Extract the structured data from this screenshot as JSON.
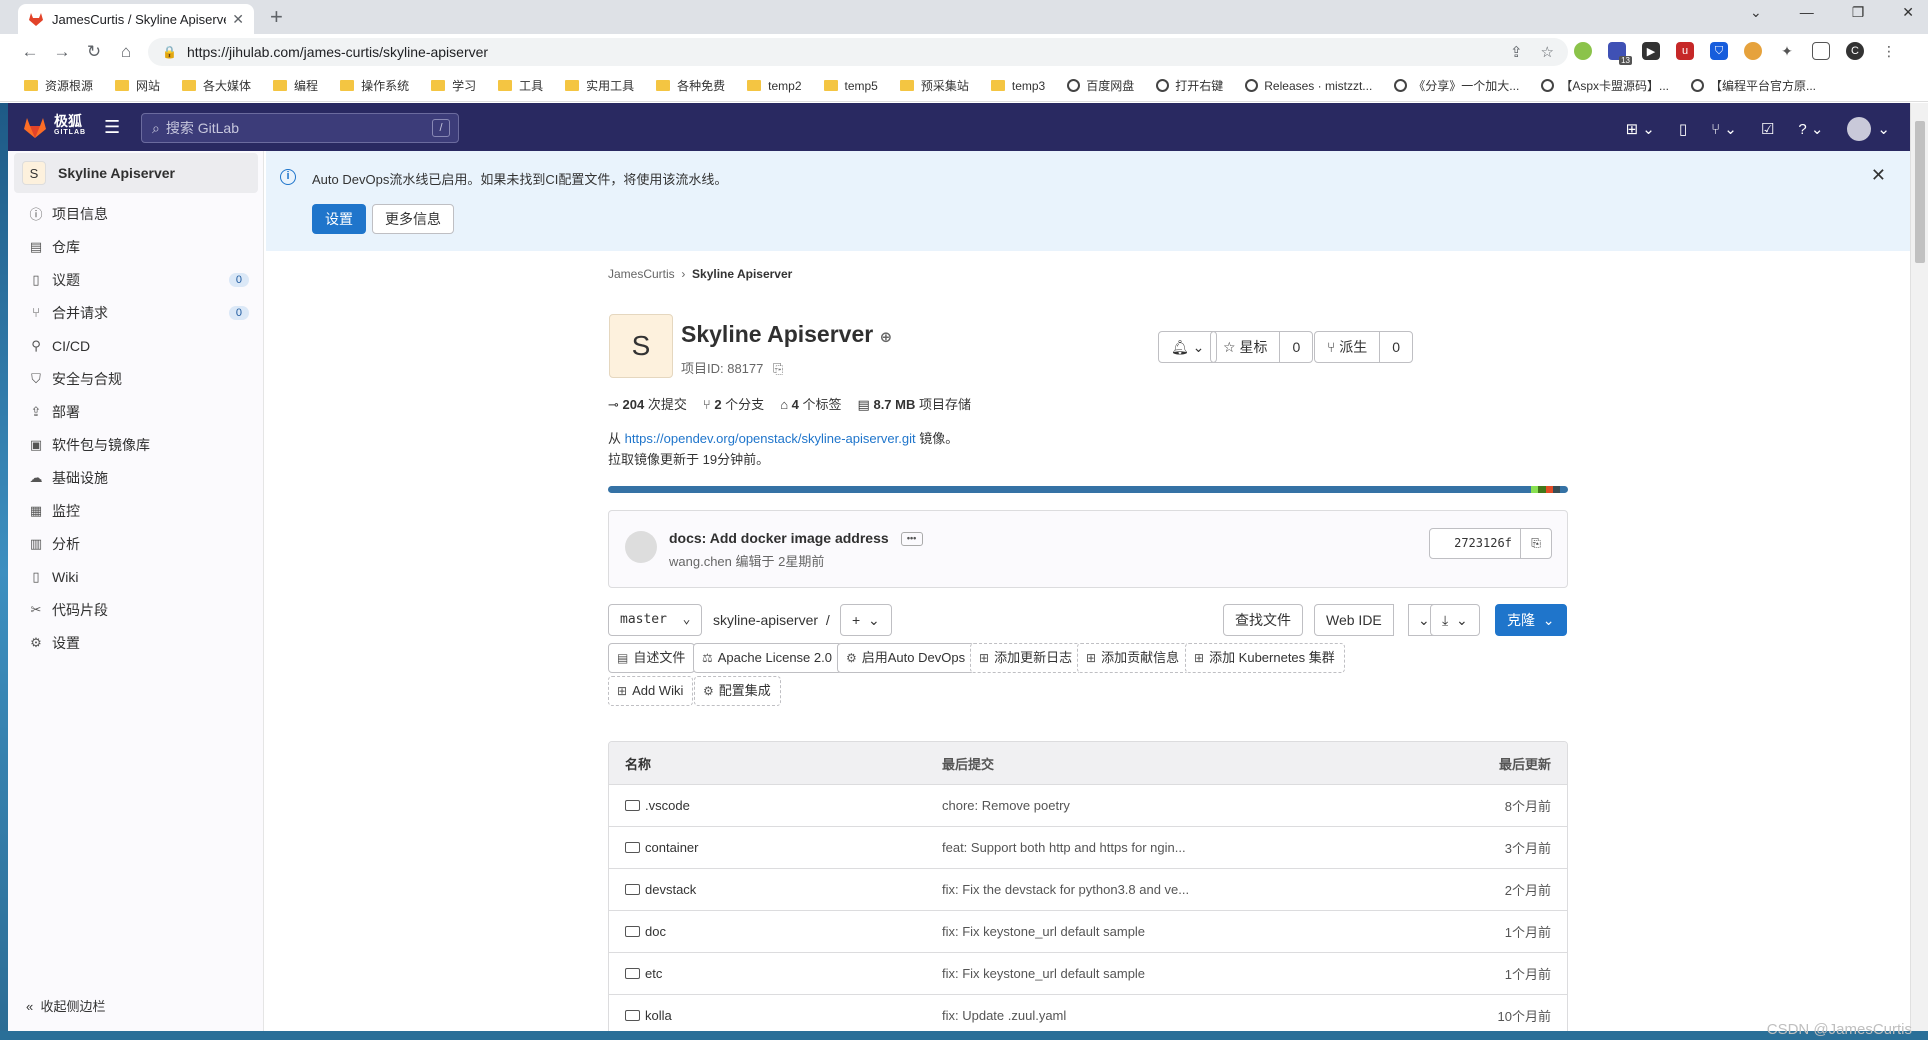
{
  "browser": {
    "tab_title": "JamesCurtis / Skyline Apiserve",
    "url": "https://jihulab.com/james-curtis/skyline-apiserver",
    "ext_badge": "13",
    "profile_initial": "C"
  },
  "bookmarks": [
    {
      "label": "资源根源",
      "type": "folder"
    },
    {
      "label": "网站",
      "type": "folder"
    },
    {
      "label": "各大媒体",
      "type": "folder"
    },
    {
      "label": "编程",
      "type": "folder"
    },
    {
      "label": "操作系统",
      "type": "folder"
    },
    {
      "label": "学习",
      "type": "folder"
    },
    {
      "label": "工具",
      "type": "folder"
    },
    {
      "label": "实用工具",
      "type": "folder"
    },
    {
      "label": "各种免费",
      "type": "folder"
    },
    {
      "label": "temp2",
      "type": "folder"
    },
    {
      "label": "temp5",
      "type": "folder"
    },
    {
      "label": "预采集站",
      "type": "folder"
    },
    {
      "label": "temp3",
      "type": "folder"
    },
    {
      "label": "百度网盘",
      "type": "globe"
    },
    {
      "label": "打开右键",
      "type": "globe"
    },
    {
      "label": "Releases · mistzzt...",
      "type": "github"
    },
    {
      "label": "《分享》一个加大...",
      "type": "site"
    },
    {
      "label": "【Aspx卡盟源码】...",
      "type": "site"
    },
    {
      "label": "【编程平台官方原...",
      "type": "globe"
    }
  ],
  "gitlab": {
    "logo_text": "极狐",
    "logo_sub": "GITLAB",
    "search_placeholder": "搜索 GitLab",
    "search_shortcut": "/"
  },
  "sidebar": {
    "project_initial": "S",
    "project_name": "Skyline Apiserver",
    "items": [
      {
        "label": "项目信息",
        "icon": "info-icon"
      },
      {
        "label": "仓库",
        "icon": "doc-icon"
      },
      {
        "label": "议题",
        "icon": "issues-icon",
        "count": "0"
      },
      {
        "label": "合并请求",
        "icon": "merge-icon",
        "count": "0"
      },
      {
        "label": "CI/CD",
        "icon": "rocket-icon"
      },
      {
        "label": "安全与合规",
        "icon": "shield-icon"
      },
      {
        "label": "部署",
        "icon": "deploy-icon"
      },
      {
        "label": "软件包与镜像库",
        "icon": "package-icon"
      },
      {
        "label": "基础设施",
        "icon": "cloud-icon"
      },
      {
        "label": "监控",
        "icon": "monitor-icon"
      },
      {
        "label": "分析",
        "icon": "chart-icon"
      },
      {
        "label": "Wiki",
        "icon": "book-icon"
      },
      {
        "label": "代码片段",
        "icon": "snippet-icon"
      },
      {
        "label": "设置",
        "icon": "gear-icon"
      }
    ],
    "collapse_label": "收起侧边栏"
  },
  "banner": {
    "message": "Auto DevOps流水线已启用。如果未找到CI配置文件，将使用该流水线。",
    "settings_label": "设置",
    "more_label": "更多信息"
  },
  "breadcrumb": {
    "owner": "JamesCurtis",
    "project": "Skyline Apiserver"
  },
  "project": {
    "initial": "S",
    "title": "Skyline Apiserver",
    "id_text": "项目ID: 88177",
    "star_label": "星标",
    "star_count": "0",
    "fork_label": "派生",
    "fork_count": "0",
    "stats": {
      "commits_num": "204",
      "commits_label": "次提交",
      "branches_num": "2",
      "branches_label": "个分支",
      "tags_num": "4",
      "tags_label": "个标签",
      "storage_num": "8.7 MB",
      "storage_label": "项目存储"
    },
    "mirror_prefix": "从",
    "mirror_url": "https://opendev.org/openstack/skyline-apiserver.git",
    "mirror_suffix": "镜像。",
    "mirror_updated": "拉取镜像更新于 19分钟前。"
  },
  "languages": [
    {
      "color": "#3572a5",
      "share": 0.961
    },
    {
      "color": "#89e051",
      "share": 0.008
    },
    {
      "color": "#427819",
      "share": 0.008
    },
    {
      "color": "#e34c26",
      "share": 0.007
    },
    {
      "color": "#384d54",
      "share": 0.008
    },
    {
      "color": "#3572a5",
      "share": 0.008
    }
  ],
  "commit": {
    "title": "docs: Add docker image address",
    "author": "wang.chen",
    "meta": "编辑于 2星期前",
    "sha": "2723126f"
  },
  "toolbar": {
    "branch": "master",
    "path": "skyline-apiserver",
    "path_sep": "/",
    "add": "+",
    "find_file": "查找文件",
    "web_ide": "Web IDE",
    "clone": "克隆"
  },
  "shortcuts": [
    {
      "label": "自述文件",
      "icon": "doc-icon",
      "dashed": false
    },
    {
      "label": "Apache License 2.0",
      "icon": "scale-icon",
      "dashed": false
    },
    {
      "label": "启用Auto DevOps",
      "icon": "gear-icon",
      "dashed": false
    },
    {
      "label": "添加更新日志",
      "icon": "plus-square-icon",
      "dashed": true
    },
    {
      "label": "添加贡献信息",
      "icon": "plus-square-icon",
      "dashed": true
    },
    {
      "label": "添加 Kubernetes 集群",
      "icon": "plus-square-icon",
      "dashed": true
    },
    {
      "label": "Add Wiki",
      "icon": "plus-square-icon",
      "dashed": true
    },
    {
      "label": "配置集成",
      "icon": "gear-icon",
      "dashed": true
    }
  ],
  "files": {
    "headers": {
      "name": "名称",
      "commit": "最后提交",
      "updated": "最后更新"
    },
    "rows": [
      {
        "name": ".vscode",
        "commit": "chore: Remove poetry",
        "updated": "8个月前"
      },
      {
        "name": "container",
        "commit": "feat: Support both http and https for ngin...",
        "updated": "3个月前"
      },
      {
        "name": "devstack",
        "commit": "fix: Fix the devstack for python3.8 and ve...",
        "updated": "2个月前"
      },
      {
        "name": "doc",
        "commit": "fix: Fix keystone_url default sample",
        "updated": "1个月前"
      },
      {
        "name": "etc",
        "commit": "fix: Fix keystone_url default sample",
        "updated": "1个月前"
      },
      {
        "name": "kolla",
        "commit": "fix: Update .zuul.yaml",
        "updated": "10个月前"
      }
    ]
  },
  "watermark": "CSDN @JamesCurtis"
}
